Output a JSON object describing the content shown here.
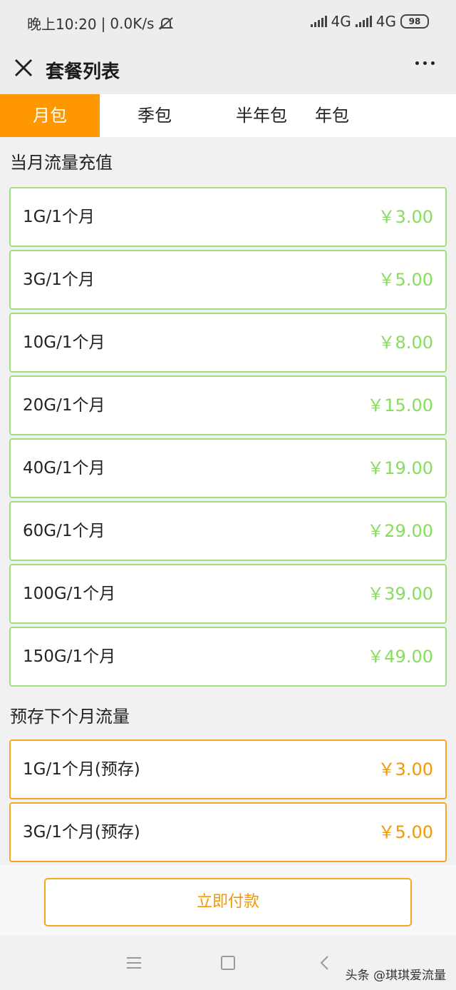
{
  "status": {
    "time": "晚上10:20",
    "divider": "|",
    "speed": "0.0K/s",
    "net1": "4G",
    "net2": "4G",
    "battery": "98"
  },
  "nav": {
    "title": "套餐列表"
  },
  "tabs": [
    "月包",
    "季包",
    "半年包",
    "年包"
  ],
  "sections": [
    {
      "title": "当月流量充值",
      "items": [
        {
          "label": "1G/1个月",
          "price": "￥3.00"
        },
        {
          "label": "3G/1个月",
          "price": "￥5.00"
        },
        {
          "label": "10G/1个月",
          "price": "￥8.00"
        },
        {
          "label": "20G/1个月",
          "price": "￥15.00"
        },
        {
          "label": "40G/1个月",
          "price": "￥19.00"
        },
        {
          "label": "60G/1个月",
          "price": "￥29.00"
        },
        {
          "label": "100G/1个月",
          "price": "￥39.00"
        },
        {
          "label": "150G/1个月",
          "price": "￥49.00"
        }
      ]
    },
    {
      "title": "预存下个月流量",
      "items": [
        {
          "label": "1G/1个月(预存)",
          "price": "￥3.00"
        },
        {
          "label": "3G/1个月(预存)",
          "price": "￥5.00"
        },
        {
          "label": "",
          "price": ""
        }
      ]
    }
  ],
  "pay_label": "立即付款",
  "watermark": "头条 @琪琪爱流量",
  "colors": {
    "accent": "#ff9800",
    "price_green": "#86de5c",
    "price_orange": "#f39800"
  }
}
